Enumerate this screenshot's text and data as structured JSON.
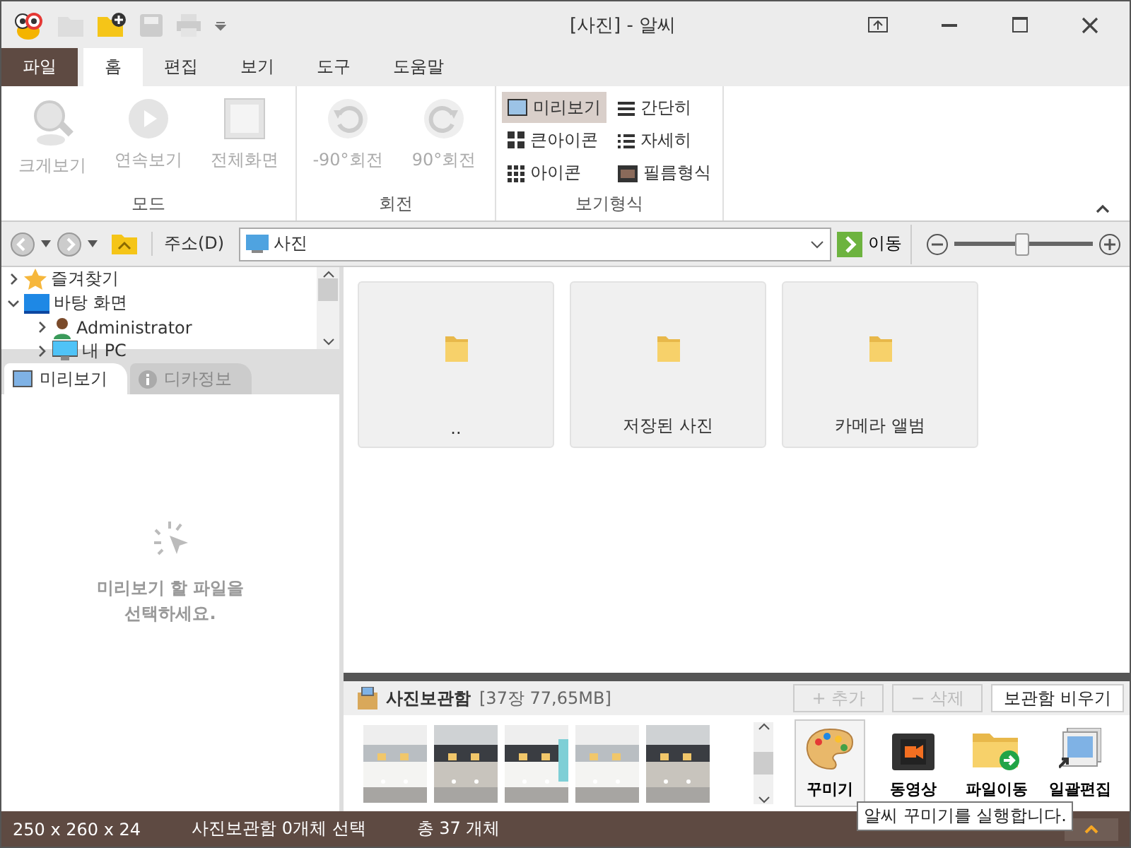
{
  "window": {
    "title": "[사진] - 알씨"
  },
  "file_menu": "파일",
  "menu_tabs": [
    {
      "label": "홈",
      "selected": true
    },
    {
      "label": "편집",
      "selected": false
    },
    {
      "label": "보기",
      "selected": false
    },
    {
      "label": "도구",
      "selected": false
    },
    {
      "label": "도움말",
      "selected": false
    }
  ],
  "ribbon": {
    "mode": {
      "label": "모드",
      "buttons": [
        {
          "label": "크게보기",
          "kind": "zoom",
          "disabled": true
        },
        {
          "label": "연속보기",
          "kind": "play",
          "disabled": true
        },
        {
          "label": "전체화면",
          "kind": "full",
          "disabled": true
        }
      ]
    },
    "rotate": {
      "label": "회전",
      "buttons": [
        {
          "label": "-90°회전",
          "kind": "ccw",
          "disabled": true
        },
        {
          "label": "90°회전",
          "kind": "cw",
          "disabled": true
        }
      ]
    },
    "view": {
      "label": "보기형식",
      "options": [
        {
          "label": "미리보기",
          "kind": "preview",
          "selected": true
        },
        {
          "label": "간단히",
          "kind": "list",
          "selected": false
        },
        {
          "label": "큰아이콘",
          "kind": "large",
          "selected": false
        },
        {
          "label": "자세히",
          "kind": "details",
          "selected": false
        },
        {
          "label": "아이콘",
          "kind": "small",
          "selected": false
        },
        {
          "label": "필름형식",
          "kind": "film",
          "selected": false
        }
      ]
    }
  },
  "address": {
    "label": "주소(D)",
    "value": "사진",
    "go": "이동",
    "zoom": {
      "level": 0.49
    }
  },
  "tree": [
    {
      "label": "즐겨찾기",
      "kind": "star",
      "expanded": false
    },
    {
      "label": "바탕 화면",
      "kind": "desktop",
      "expanded": true,
      "children": [
        {
          "label": "Administrator",
          "kind": "user",
          "expanded": false
        },
        {
          "label": "내 PC",
          "kind": "pc",
          "expanded": false
        }
      ]
    }
  ],
  "left_tabs": [
    {
      "label": "미리보기",
      "selected": true
    },
    {
      "label": "디카정보",
      "selected": false
    }
  ],
  "preview_hint": "미리보기 할 파일을\n선택하세요.",
  "folders": [
    {
      "label": ".."
    },
    {
      "label": "저장된 사진"
    },
    {
      "label": "카메라 앨범"
    }
  ],
  "album": {
    "title": "사진보관함",
    "info": "[37장 77,65MB]",
    "add": "+ 추가",
    "remove": "− 삭제",
    "empty": "보관함 비우기",
    "tools": [
      {
        "label": "꾸미기",
        "kind": "palette",
        "selected": true
      },
      {
        "label": "동영상",
        "kind": "video",
        "selected": false
      },
      {
        "label": "파일이동",
        "kind": "move",
        "selected": false
      },
      {
        "label": "일괄편집",
        "kind": "batch",
        "selected": false
      }
    ]
  },
  "tooltip": "알씨 꾸미기를 실행합니다.",
  "status_bar": [
    "250 x 260 x 24",
    "사진보관함 0개체 선택",
    "총 37 개체"
  ]
}
